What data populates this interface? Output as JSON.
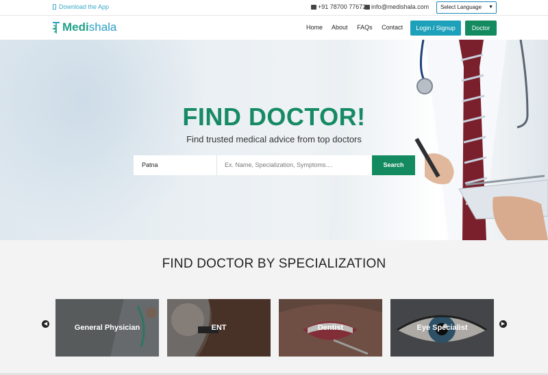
{
  "topbar": {
    "download_app": "Download the App",
    "phone": "+91 78700 77672",
    "email": "info@medishala.com",
    "language_select": "Select Language"
  },
  "nav": {
    "logo_part1": "Medi",
    "logo_part2": "shala",
    "links": [
      "Home",
      "About",
      "FAQs",
      "Contact"
    ],
    "login_signup": "Login / Signup",
    "doctor": "Doctor"
  },
  "hero": {
    "title": "FIND DOCTOR!",
    "subtitle": "Find trusted medical advice from top doctors",
    "city_value": "Patna",
    "search_placeholder": "Ex. Name, Specialization, Symptoms....",
    "search_button": "Search"
  },
  "specializations": {
    "title": "FIND DOCTOR BY SPECIALIZATION",
    "cards": [
      "General Physician",
      "ENT",
      "Dentist",
      "Eye Specialist"
    ]
  }
}
